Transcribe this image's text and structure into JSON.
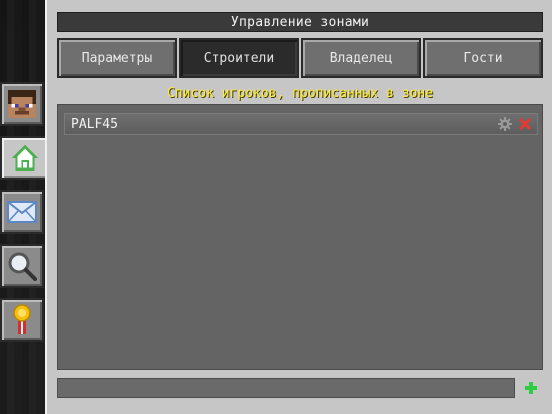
{
  "window": {
    "title": "Управление зонами"
  },
  "tabs": [
    {
      "label": "Параметры",
      "active": false
    },
    {
      "label": "Строители",
      "active": true
    },
    {
      "label": "Владелец",
      "active": false
    },
    {
      "label": "Гости",
      "active": false
    }
  ],
  "list": {
    "caption": "Список игроков, прописанных в зоне",
    "items": [
      {
        "name": "PALF45",
        "actions": [
          "gear-icon",
          "close-icon"
        ]
      }
    ]
  },
  "bottom": {
    "add_icon": "plus-icon"
  },
  "sidebar": {
    "items": [
      {
        "icon": "player-head-icon"
      },
      {
        "icon": "home-icon",
        "active": true
      },
      {
        "icon": "mail-icon"
      },
      {
        "icon": "magnifier-icon"
      },
      {
        "icon": "medal-icon"
      }
    ]
  },
  "colors": {
    "caption": "#ffeb3b",
    "active_tab": "#2b2b2b",
    "add": "#2ecc40",
    "remove": "#e53935"
  }
}
